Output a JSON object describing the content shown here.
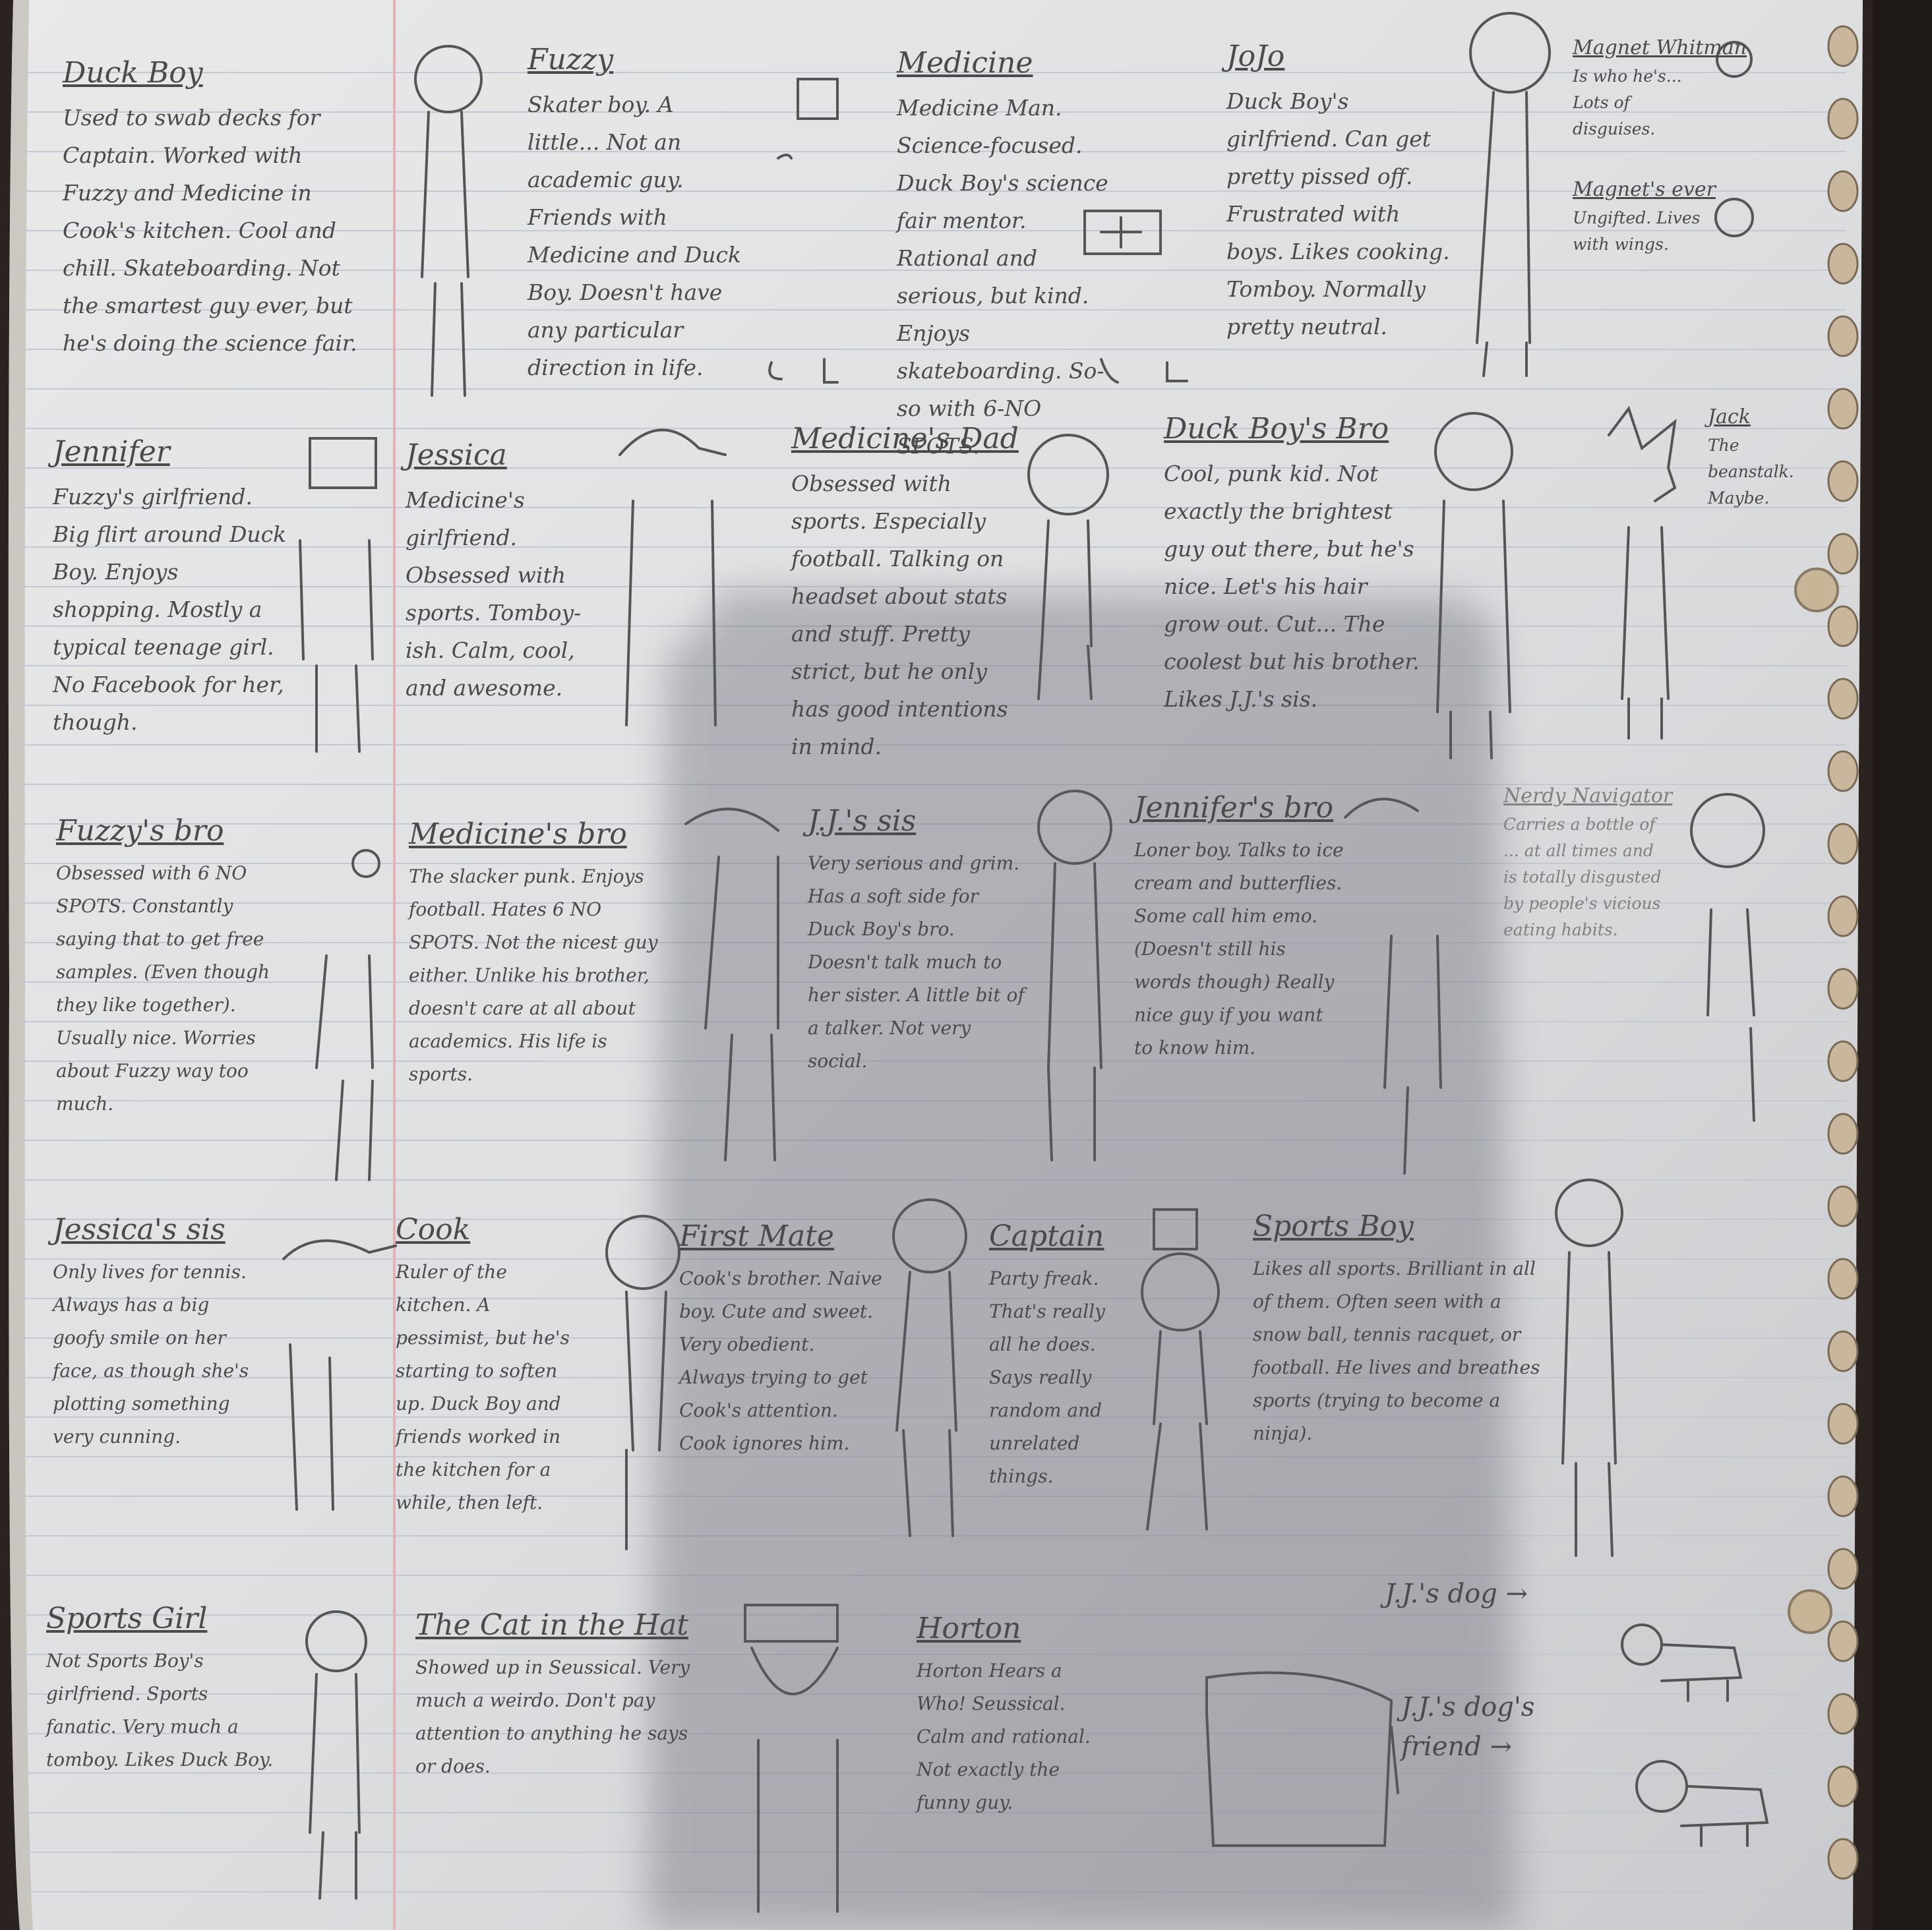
{
  "characters": [
    {
      "name": "Duck Boy",
      "desc": "Used to swab decks for Captain. Worked with Fuzzy and Medicine in Cook's kitchen. Cool and chill. Skateboarding. Not the smartest guy ever, but he's doing the science fair."
    },
    {
      "name": "Fuzzy",
      "desc": "Skater boy. A little... Not an academic guy. Friends with Medicine and Duck Boy. Doesn't have any particular direction in life."
    },
    {
      "name": "Medicine",
      "desc": "Medicine Man. Science-focused. Duck Boy's science fair mentor. Rational and serious, but kind. Enjoys skateboarding. So-so with 6-NO SPOTS."
    },
    {
      "name": "JoJo",
      "desc": "Duck Boy's girlfriend. Can get pretty pissed off. Frustrated with boys. Likes cooking. Tomboy. Normally pretty neutral."
    },
    {
      "name": "Magnet Whitman",
      "desc": "Is who he's... Lots of disguises."
    },
    {
      "name": "Magnet's ever",
      "desc": "Ungifted. Lives with wings."
    },
    {
      "name": "Jennifer",
      "desc": "Fuzzy's girlfriend. Big flirt around Duck Boy. Enjoys shopping. Mostly a typical teenage girl. No Facebook for her, though."
    },
    {
      "name": "Jessica",
      "desc": "Medicine's girlfriend. Obsessed with sports. Tomboy-ish. Calm, cool, and awesome."
    },
    {
      "name": "Medicine's Dad",
      "desc": "Obsessed with sports. Especially football. Talking on headset about stats and stuff. Pretty strict, but he only has good intentions in mind."
    },
    {
      "name": "Duck Boy's Bro",
      "desc": "Cool, punk kid. Not exactly the brightest guy out there, but he's nice. Let's his hair grow out. Cut... The coolest but his brother. Likes J.J.'s sis."
    },
    {
      "name": "Jack",
      "desc": "The beanstalk. Maybe."
    },
    {
      "name": "Fuzzy's bro",
      "desc": "Obsessed with 6 NO SPOTS. Constantly saying that to get free samples. (Even though they like together). Usually nice. Worries about Fuzzy way too much."
    },
    {
      "name": "Medicine's bro",
      "desc": "The slacker punk. Enjoys football. Hates 6 NO SPOTS. Not the nicest guy either. Unlike his brother, doesn't care at all about academics. His life is sports."
    },
    {
      "name": "J.J.'s sis",
      "desc": "Very serious and grim. Has a soft side for Duck Boy's bro. Doesn't talk much to her sister. A little bit of a talker. Not very social."
    },
    {
      "name": "Jennifer's bro",
      "desc": "Loner boy. Talks to ice cream and butterflies. Some call him emo. (Doesn't still his words though) Really nice guy if you want to know him."
    },
    {
      "name": "Nerdy Navigator",
      "desc": "Carries a bottle of ... at all times and is totally disgusted by people's vicious eating habits."
    },
    {
      "name": "Jessica's sis",
      "desc": "Only lives for tennis. Always has a big goofy smile on her face, as though she's plotting something very cunning."
    },
    {
      "name": "Cook",
      "desc": "Ruler of the kitchen. A pessimist, but he's starting to soften up. Duck Boy and friends worked in the kitchen for a while, then left."
    },
    {
      "name": "First Mate",
      "desc": "Cook's brother. Naive boy. Cute and sweet. Very obedient. Always trying to get Cook's attention. Cook ignores him."
    },
    {
      "name": "Captain",
      "desc": "Party freak. That's really all he does. Says really random and unrelated things."
    },
    {
      "name": "Sports Boy",
      "desc": "Likes all sports. Brilliant in all of them. Often seen with a snow ball, tennis racquet, or football. He lives and breathes sports (trying to become a ninja)."
    },
    {
      "name": "Sports Girl",
      "desc": "Not Sports Boy's girlfriend. Sports fanatic. Very much a tomboy. Likes Duck Boy."
    },
    {
      "name": "The Cat in the Hat",
      "desc": "Showed up in Seussical. Very much a weirdo. Don't pay attention to anything he says or does."
    },
    {
      "name": "Horton",
      "desc": "Horton Hears a Who! Seussical. Calm and rational. Not exactly the funny guy."
    }
  ],
  "pets": [
    {
      "label": "J.J.'s dog →"
    },
    {
      "label": "J.J.'s dog's friend →"
    }
  ]
}
